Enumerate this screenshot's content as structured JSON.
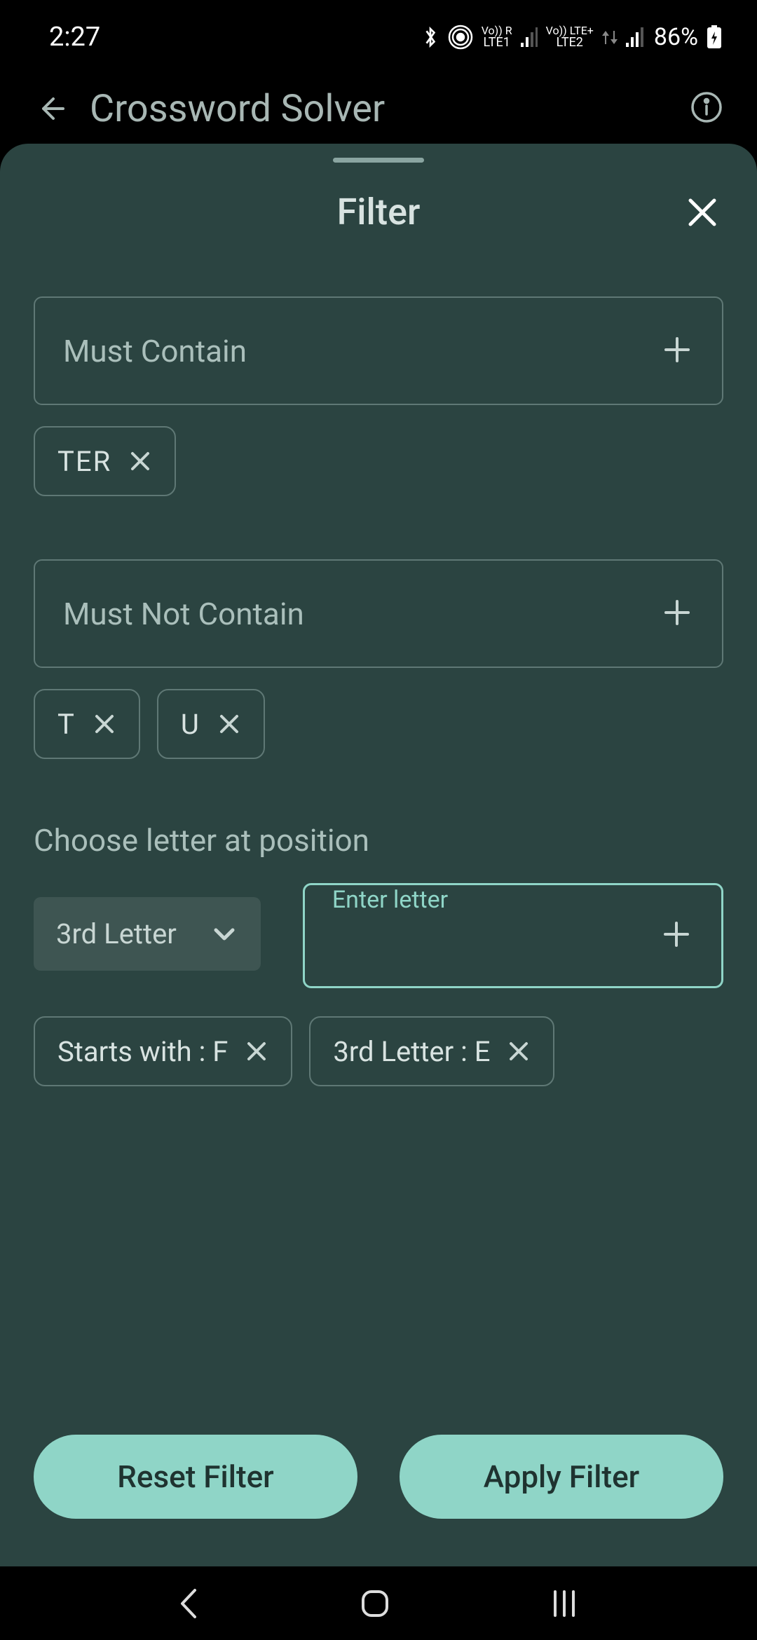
{
  "status": {
    "time": "2:27",
    "battery": "86%",
    "lte1_top": "Vo)) R",
    "lte1_bottom": "LTE1",
    "lte2_top": "Vo)) LTE+",
    "lte2_bottom": "LTE2"
  },
  "header": {
    "title": "Crossword Solver"
  },
  "modal": {
    "title": "Filter",
    "must_contain_label": "Must Contain",
    "must_not_contain_label": "Must Not Contain",
    "position_label": "Choose letter at position",
    "dropdown_value": "3rd Letter",
    "enter_letter_label": "Enter letter",
    "reset_label": "Reset Filter",
    "apply_label": "Apply Filter"
  },
  "must_contain_chips": {
    "c0": "TER"
  },
  "must_not_contain_chips": {
    "c0": "T",
    "c1": "U"
  },
  "position_chips": {
    "c0": "Starts with : F",
    "c1": "3rd Letter : E"
  }
}
